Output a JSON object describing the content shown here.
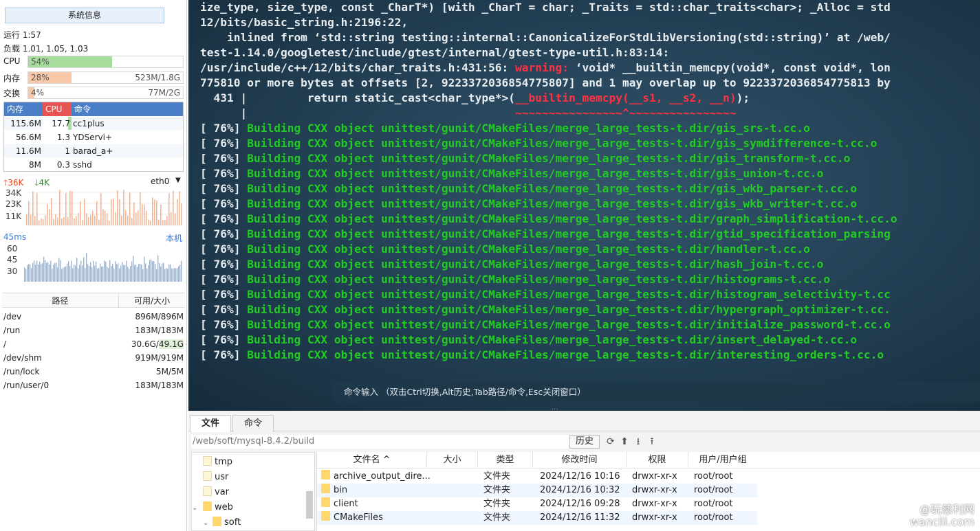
{
  "sysinfo": {
    "title": "系统信息",
    "uptime": "运行 1:57",
    "load": "负载 1.01, 1.05, 1.03",
    "cpu": {
      "label": "CPU",
      "percent_text": "54%",
      "value": 54
    },
    "mem": {
      "label": "内存",
      "percent_text": "28%",
      "value": 28,
      "detail": "523M/1.8G"
    },
    "swap": {
      "label": "交换",
      "percent_text": "4%",
      "value": 4,
      "detail": "77M/2G"
    },
    "proc_headers": [
      "内存",
      "CPU",
      "命令"
    ],
    "processes": [
      {
        "mem": "115.6M",
        "cpu": "17.7",
        "cmd": "cc1plus"
      },
      {
        "mem": "56.6M",
        "cpu": "1.3",
        "cmd": "YDServi+"
      },
      {
        "mem": "11.6M",
        "cpu": "1",
        "cmd": "barad_a+"
      },
      {
        "mem": "8M",
        "cpu": "0.3",
        "cmd": "sshd"
      }
    ],
    "net": {
      "up": "36K",
      "down": "4K",
      "iface": "eth0",
      "ticks": [
        "34K",
        "23K",
        "11K"
      ]
    },
    "ping": {
      "latency": "45ms",
      "target": "本机",
      "ticks": [
        "60",
        "45",
        "30"
      ]
    },
    "disk_headers": [
      "路径",
      "可用/大小"
    ],
    "disks": [
      {
        "path": "/dev",
        "size": "896M/896M"
      },
      {
        "path": "/run",
        "size": "183M/183M"
      },
      {
        "path": "/",
        "size_a": "30.6G/",
        "size_b": "49.1G"
      },
      {
        "path": "/dev/shm",
        "size": "919M/919M"
      },
      {
        "path": "/run/lock",
        "size": "5M/5M"
      },
      {
        "path": "/run/user/0",
        "size": "183M/183M"
      }
    ]
  },
  "terminal": {
    "lines_plain": [
      "ize_type, size_type, const _CharT*) [with _CharT = char; _Traits = std::char_traits<char>; _Alloc = std",
      "12/bits/basic_string.h:2196:22,",
      "    inlined from ‘std::string testing::internal::CanonicalizeForStdLibVersioning(std::string)’ at /web/",
      "test-1.14.0/googletest/include/gtest/internal/gtest-type-util.h:83:14:"
    ],
    "warn_line": {
      "pre": "/usr/include/c++/12/bits/char_traits.h:431:56: ",
      "warn": "warning:",
      "post": " ‘void* __builtin_memcpy(void*, const void*, lon"
    },
    "line6": "775810 or more bytes at offsets [2, 9223372036854775807] and 1 may overlap up to 9223372036854775813 by",
    "code_line": {
      "pre": "  431 |         return static_cast<char_type*>(",
      "hl": "__builtin_memcpy(__s1, __s2, __n)",
      "post": ");"
    },
    "caret_line": {
      "pre": "      |                                        ",
      "hl": "~~~~~~~~~~~~~~~~^~~~~~~~~~~~~~~~~"
    },
    "build_prefix": "[ 76%] ",
    "build_lines": [
      "Building CXX object unittest/gunit/CMakeFiles/merge_large_tests-t.dir/gis_srs-t.cc.o",
      "Building CXX object unittest/gunit/CMakeFiles/merge_large_tests-t.dir/gis_symdifference-t.cc.o",
      "Building CXX object unittest/gunit/CMakeFiles/merge_large_tests-t.dir/gis_transform-t.cc.o",
      "Building CXX object unittest/gunit/CMakeFiles/merge_large_tests-t.dir/gis_union-t.cc.o",
      "Building CXX object unittest/gunit/CMakeFiles/merge_large_tests-t.dir/gis_wkb_parser-t.cc.o",
      "Building CXX object unittest/gunit/CMakeFiles/merge_large_tests-t.dir/gis_wkb_writer-t.cc.o",
      "Building CXX object unittest/gunit/CMakeFiles/merge_large_tests-t.dir/graph_simplification-t.cc.o",
      "Building CXX object unittest/gunit/CMakeFiles/merge_large_tests-t.dir/gtid_specification_parsing",
      "Building CXX object unittest/gunit/CMakeFiles/merge_large_tests-t.dir/handler-t.cc.o",
      "Building CXX object unittest/gunit/CMakeFiles/merge_large_tests-t.dir/hash_join-t.cc.o",
      "Building CXX object unittest/gunit/CMakeFiles/merge_large_tests-t.dir/histograms-t.cc.o",
      "Building CXX object unittest/gunit/CMakeFiles/merge_large_tests-t.dir/histogram_selectivity-t.cc",
      "Building CXX object unittest/gunit/CMakeFiles/merge_large_tests-t.dir/hypergraph_optimizer-t.cc.",
      "Building CXX object unittest/gunit/CMakeFiles/merge_large_tests-t.dir/initialize_password-t.cc.o",
      "Building CXX object unittest/gunit/CMakeFiles/merge_large_tests-t.dir/insert_delayed-t.cc.o",
      "Building CXX object unittest/gunit/CMakeFiles/merge_large_tests-t.dir/interesting_orders-t.cc.o"
    ],
    "cmd_hint": "命令输入 （双击Ctrl切换,Alt历史,Tab路径/命令,Esc关闭窗口）"
  },
  "filemanager": {
    "tabs": [
      "文件",
      "命令"
    ],
    "path": "/web/soft/mysql-8.4.2/build",
    "history_label": "历史",
    "tree": [
      {
        "name": "tmp",
        "pale": true
      },
      {
        "name": "usr",
        "pale": true
      },
      {
        "name": "var",
        "pale": true
      },
      {
        "name": "web",
        "pale": false
      },
      {
        "name": "soft",
        "pale": false
      }
    ],
    "columns": [
      "文件名 ^",
      "大小",
      "类型",
      "修改时间",
      "权限",
      "用户/用户组"
    ],
    "files": [
      {
        "name": "archive_output_dire...",
        "type": "文件夹",
        "mtime": "2024/12/16 10:16",
        "perm": "drwxr-xr-x",
        "owner": "root/root"
      },
      {
        "name": "bin",
        "type": "文件夹",
        "mtime": "2024/12/16 10:32",
        "perm": "drwxr-xr-x",
        "owner": "root/root"
      },
      {
        "name": "client",
        "type": "文件夹",
        "mtime": "2024/12/16 09:28",
        "perm": "drwxr-xr-x",
        "owner": "root/root"
      },
      {
        "name": "CMakeFiles",
        "type": "文件夹",
        "mtime": "2024/12/16 11:32",
        "perm": "drwxr-xr-x",
        "owner": "root/root"
      }
    ]
  },
  "watermark": {
    "line1": "@玩慈利网",
    "line2": "wancili.com"
  },
  "colors": {
    "cpu_bar": "#a6dc9c",
    "mem_bar": "#f9c8a8",
    "swap_bar": "#f9c8a8",
    "proc_head": "#4a7fc8",
    "proc_cpu_head": "#e55353",
    "term_warn": "#ff3040",
    "term_green": "#22cc22"
  }
}
